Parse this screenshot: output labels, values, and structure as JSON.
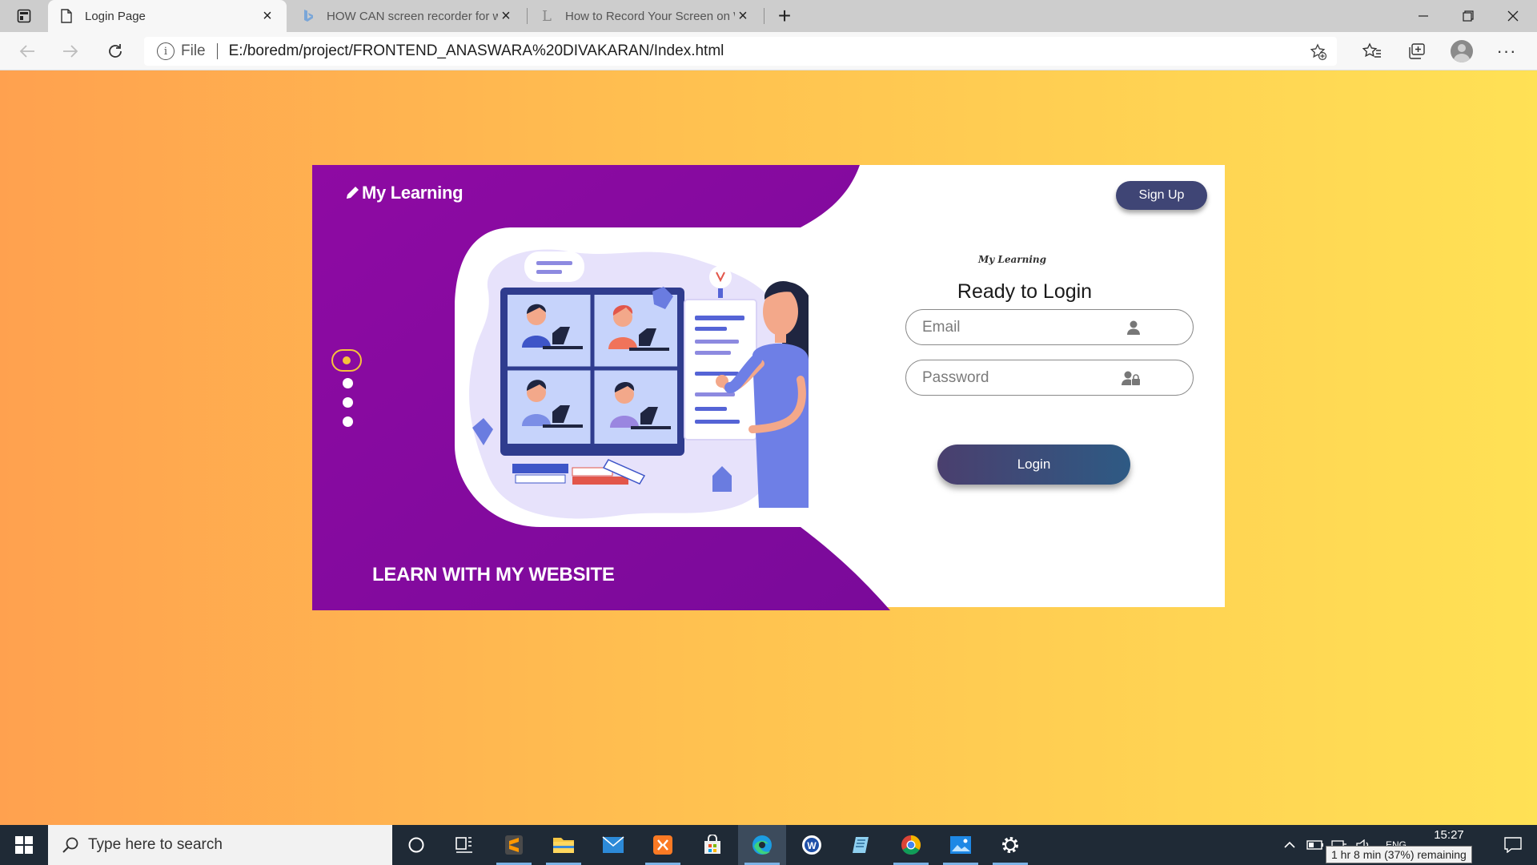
{
  "browser": {
    "tabs": [
      {
        "label": "Login Page",
        "icon": "page-icon",
        "active": true
      },
      {
        "label": "HOW CAN screen recorder for w",
        "icon": "bing-icon",
        "active": false
      },
      {
        "label": "How to Record Your Screen on W",
        "icon": "letter-l-icon",
        "active": false
      }
    ],
    "address": {
      "scheme_label": "File",
      "url": "E:/boredm/project/FRONTEND_ANASWARA%20DIVAKARAN/Index.html"
    }
  },
  "page": {
    "brand": "My Learning",
    "tagline": "LEARN WITH MY WEBSITE",
    "signup_label": "Sign Up",
    "mini_logo": "My Learning",
    "form_title": "Ready to Login",
    "email_placeholder": "Email",
    "password_placeholder": "Password",
    "login_label": "Login",
    "carousel": {
      "count": 4,
      "active_index": 0
    },
    "colors": {
      "purple": "#8a0a9e",
      "button_dark": "#3f4575",
      "dot_active": "#f6c33b",
      "background_from": "#ffa14f",
      "background_to": "#ffe155"
    }
  },
  "taskbar": {
    "search_placeholder": "Type here to search",
    "time": "15:27",
    "language": "ENG",
    "battery_tooltip": "1 hr 8 min (37%) remaining"
  }
}
